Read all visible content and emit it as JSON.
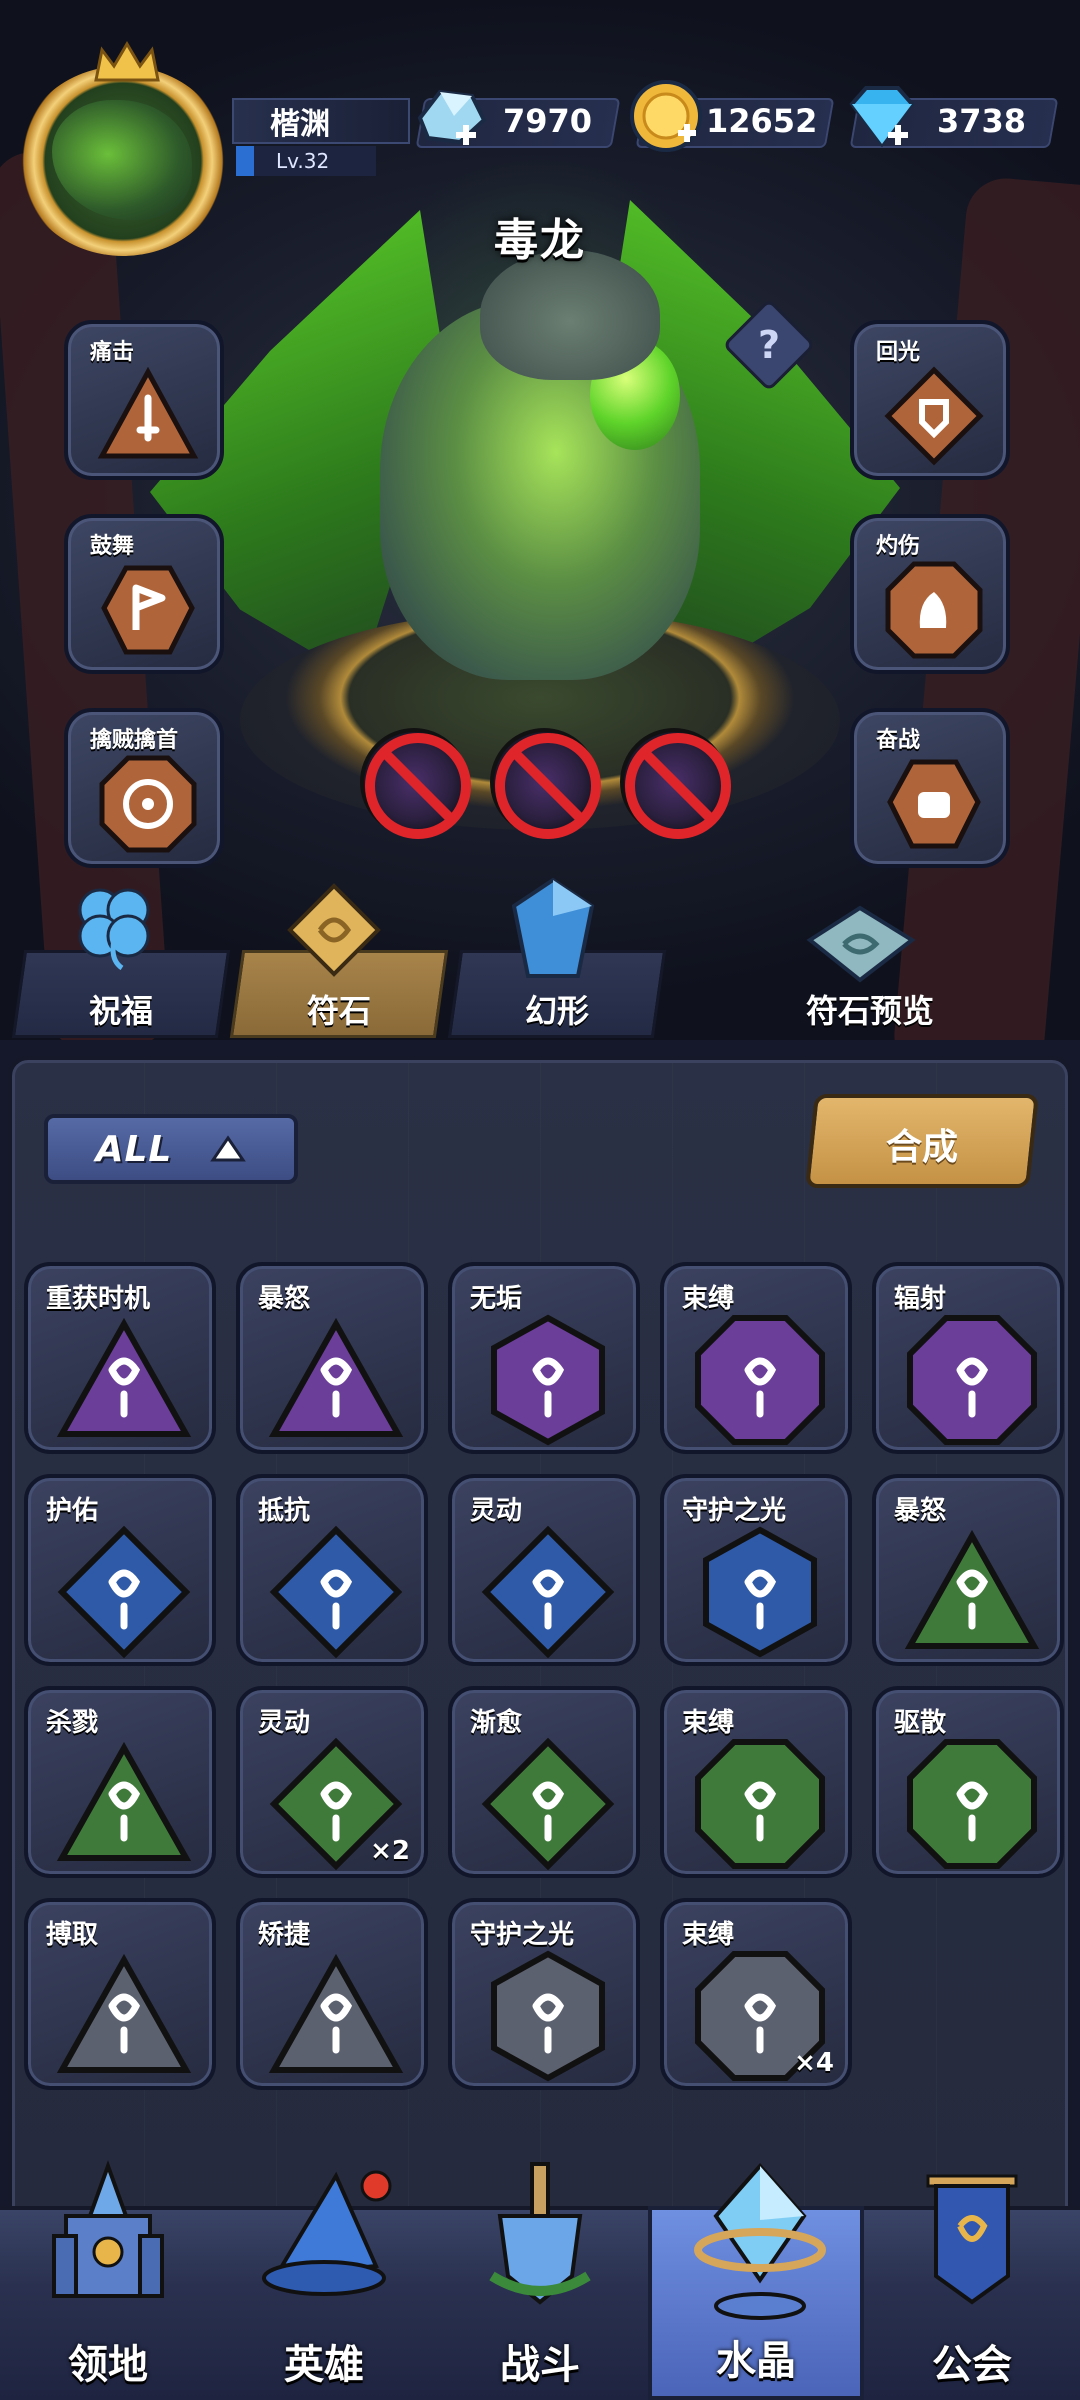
{
  "player": {
    "name": "楷渊",
    "level": "Lv.32"
  },
  "resources": [
    {
      "icon": "ice-crystal-plus-icon",
      "value": "7970"
    },
    {
      "icon": "gold-coin-icon",
      "value": "12652"
    },
    {
      "icon": "diamond-plus-icon",
      "value": "3738"
    }
  ],
  "boss": {
    "name": "毒龙",
    "help": "?"
  },
  "skills_left": [
    {
      "label": "痛击",
      "icon": "sword-rune-icon"
    },
    {
      "label": "鼓舞",
      "icon": "flag-rune-icon"
    },
    {
      "label": "擒贼擒首",
      "icon": "crosshair-rune-icon"
    }
  ],
  "skills_right": [
    {
      "label": "回光",
      "icon": "shield-sparkle-icon"
    },
    {
      "label": "灼伤",
      "icon": "flame-fist-icon"
    },
    {
      "label": "奋战",
      "icon": "fist-burst-icon"
    }
  ],
  "locked_slots": 3,
  "tabs": [
    {
      "label": "祝福",
      "icon": "clover-icon"
    },
    {
      "label": "符石",
      "icon": "rune-stone-icon",
      "active": true
    },
    {
      "label": "幻形",
      "icon": "blue-crystal-icon"
    },
    {
      "label": "符石预览",
      "icon": "rune-book-icon"
    }
  ],
  "filter": {
    "label": "ALL"
  },
  "merge": {
    "label": "合成"
  },
  "colors": {
    "purple": "#6b3e9a",
    "blue": "#2f5aa8",
    "green": "#3f7a3a",
    "gray": "#5c6170",
    "gold": "#d6a65a"
  },
  "runes": [
    {
      "label": "重获时机",
      "shape": "triangle",
      "color": "purple",
      "count": ""
    },
    {
      "label": "暴怒",
      "shape": "triangle",
      "color": "purple",
      "count": ""
    },
    {
      "label": "无垢",
      "shape": "hexagon",
      "color": "purple",
      "count": ""
    },
    {
      "label": "束缚",
      "shape": "octagon",
      "color": "purple",
      "count": ""
    },
    {
      "label": "辐射",
      "shape": "octagon",
      "color": "purple",
      "count": ""
    },
    {
      "label": "护佑",
      "shape": "diamond",
      "color": "blue",
      "count": ""
    },
    {
      "label": "抵抗",
      "shape": "diamond",
      "color": "blue",
      "count": ""
    },
    {
      "label": "灵动",
      "shape": "diamond",
      "color": "blue",
      "count": ""
    },
    {
      "label": "守护之光",
      "shape": "hexagon",
      "color": "blue",
      "count": ""
    },
    {
      "label": "暴怒",
      "shape": "triangle",
      "color": "green",
      "count": ""
    },
    {
      "label": "杀戮",
      "shape": "triangle",
      "color": "green",
      "count": ""
    },
    {
      "label": "灵动",
      "shape": "diamond",
      "color": "green",
      "count": "×2"
    },
    {
      "label": "渐愈",
      "shape": "diamond",
      "color": "green",
      "count": ""
    },
    {
      "label": "束缚",
      "shape": "octagon",
      "color": "green",
      "count": ""
    },
    {
      "label": "驱散",
      "shape": "octagon",
      "color": "green",
      "count": ""
    },
    {
      "label": "搏取",
      "shape": "triangle",
      "color": "gray",
      "count": ""
    },
    {
      "label": "矫捷",
      "shape": "triangle",
      "color": "gray",
      "count": ""
    },
    {
      "label": "守护之光",
      "shape": "hexagon",
      "color": "gray",
      "count": ""
    },
    {
      "label": "束缚",
      "shape": "octagon",
      "color": "gray",
      "count": "×4"
    }
  ],
  "nav": [
    {
      "label": "领地",
      "icon": "castle-icon"
    },
    {
      "label": "英雄",
      "icon": "wizard-hat-icon"
    },
    {
      "label": "战斗",
      "icon": "sword-shield-icon"
    },
    {
      "label": "水晶",
      "icon": "crystal-icon",
      "active": true
    },
    {
      "label": "公会",
      "icon": "guild-banner-icon"
    }
  ]
}
